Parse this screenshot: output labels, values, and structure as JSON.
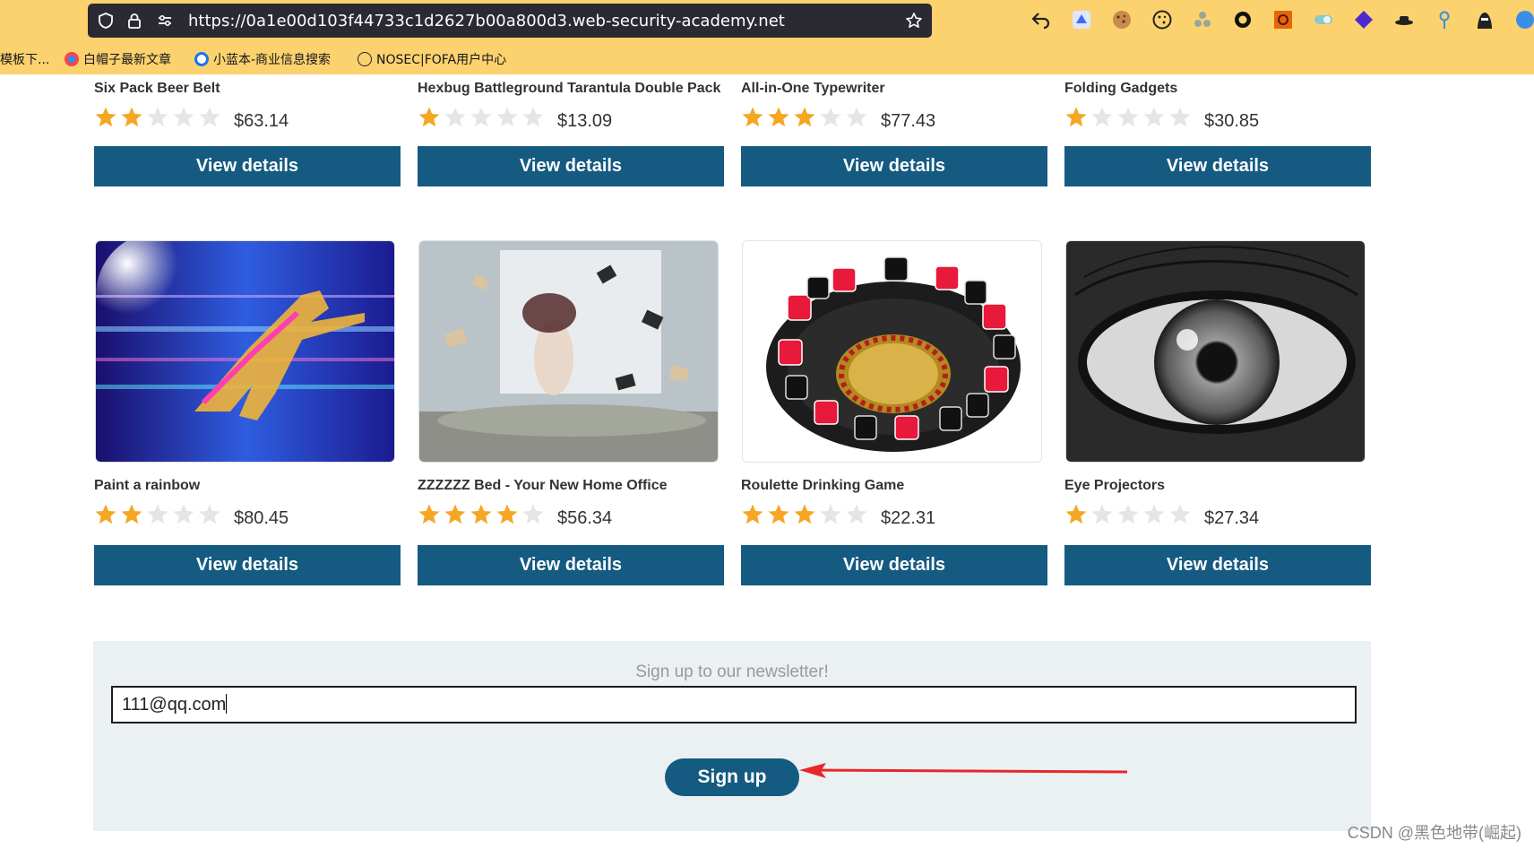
{
  "browser": {
    "url_prefix": "https://0a1e00d103f44733c1d2627b00a800d3.",
    "url_domain": "web-security-academy.net",
    "bookmarks": [
      "模板下...",
      "白帽子最新文章",
      "小蓝本-商业信息搜索",
      "NOSEC|FOFA用户中心"
    ]
  },
  "products": [
    {
      "name": "Six Pack Beer Belt",
      "rating": 2,
      "price": "$63.14",
      "button": "View details"
    },
    {
      "name": "Hexbug Battleground Tarantula Double Pack",
      "rating": 1,
      "price": "$13.09",
      "button": "View details"
    },
    {
      "name": "All-in-One Typewriter",
      "rating": 3,
      "price": "$77.43",
      "button": "View details"
    },
    {
      "name": "Folding Gadgets",
      "rating": 1,
      "price": "$30.85",
      "button": "View details"
    },
    {
      "name": "Paint a rainbow",
      "rating": 2,
      "price": "$80.45",
      "button": "View details"
    },
    {
      "name": "ZZZZZZ Bed - Your New Home Office",
      "rating": 4,
      "price": "$56.34",
      "button": "View details"
    },
    {
      "name": "Roulette Drinking Game",
      "rating": 3,
      "price": "$22.31",
      "button": "View details"
    },
    {
      "name": "Eye Projectors",
      "rating": 1,
      "price": "$27.34",
      "button": "View details"
    }
  ],
  "newsletter": {
    "title": "Sign up to our newsletter!",
    "email_value": "111@qq.com",
    "button": "Sign up"
  },
  "watermark": "CSDN @黑色地带(崛起)",
  "colors": {
    "accent": "#155a80",
    "chrome": "#fcd26f",
    "star_on": "#f5a623",
    "star_off": "#e5e5e5",
    "annotation_arrow": "#e8262b"
  }
}
